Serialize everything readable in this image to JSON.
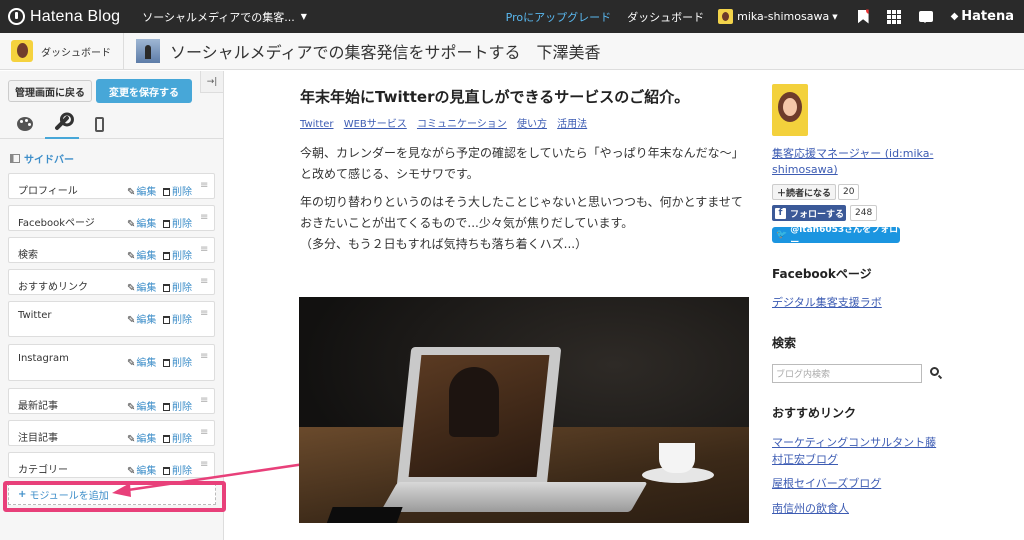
{
  "topbar": {
    "brand": "Hatena Blog",
    "blog_selector": "ソーシャルメディアでの集客...",
    "pro_upgrade": "Proにアップグレード",
    "dashboard": "ダッシュボード",
    "username": "mika-shimosawa",
    "hatena": "Hatena"
  },
  "subheader": {
    "dashboard_label": "ダッシュボード",
    "blog_title": "ソーシャルメディアでの集客発信をサポートする　下澤美香"
  },
  "editor": {
    "back_button": "管理画面に戻る",
    "save_button": "変更を保存する",
    "section_label": "サイドバー",
    "edit_label": "編集",
    "delete_label": "削除",
    "add_module": "モジュールを追加",
    "modules": [
      {
        "name": "プロフィール"
      },
      {
        "name": "Facebookページ"
      },
      {
        "name": "検索"
      },
      {
        "name": "おすすめリンク"
      },
      {
        "name": "Twitter"
      },
      {
        "name": "Instagram"
      },
      {
        "name": "最新記事"
      },
      {
        "name": "注目記事"
      },
      {
        "name": "カテゴリー"
      }
    ]
  },
  "article": {
    "title": "年末年始にTwitterの見直しができるサービスのご紹介。",
    "tags": [
      "Twitter",
      "WEBサービス",
      "コミュニケーション",
      "使い方",
      "活用法"
    ],
    "paragraph1_line1": "今朝、カレンダーを見ながら予定の確認をしていたら「やっぱり年末なんだな〜」",
    "paragraph1_line2": "と改めて感じる、シモサワです。",
    "paragraph2_line1": "年の切り替わりというのはそう大したことじゃないと思いつつも、何かとすませて",
    "paragraph2_line2": "おきたいことが出てくるもので...少々気が焦りだしています。",
    "paragraph2_line3": "（多分、もう２日もすれば気持ちも落ち着くハズ...）"
  },
  "sidebar": {
    "profile_name_line1": "集客応援マネージャー (id:mika-",
    "profile_name_line2": "shimosawa)",
    "reader_button": "読者になる",
    "reader_count": "20",
    "fb_follow": "フォローする",
    "fb_count": "248",
    "twitter_follow": "@itan6053さんをフォロー",
    "facebook_heading": "Facebookページ",
    "facebook_link": "デジタル集客支援ラボ",
    "search_heading": "検索",
    "search_placeholder": "ブログ内検索",
    "links_heading": "おすすめリンク",
    "links": [
      "マーケティングコンサルタント藤",
      "村正宏ブログ",
      "屋根セイバーズブログ",
      "南信州の飲食人"
    ]
  },
  "colors": {
    "topbar_bg": "#2a2a2a",
    "accent_blue": "#47a7d8",
    "highlight_pink": "#e8407a",
    "link": "#3d5cb3"
  }
}
